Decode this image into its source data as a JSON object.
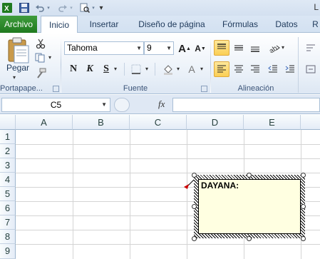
{
  "window": {
    "title_fragment": "L"
  },
  "qat": {
    "icons": [
      "excel-icon",
      "save-icon",
      "undo-icon",
      "redo-icon",
      "print-preview-icon",
      "customize-icon"
    ]
  },
  "tabs": [
    {
      "label": "Archivo"
    },
    {
      "label": "Inicio"
    },
    {
      "label": "Insertar"
    },
    {
      "label": "Diseño de página"
    },
    {
      "label": "Fórmulas"
    },
    {
      "label": "Datos"
    },
    {
      "label": "R"
    }
  ],
  "ribbon": {
    "clipboard": {
      "paste_label": "Pegar",
      "group_label": "Portapape..."
    },
    "font": {
      "font_name": "Tahoma",
      "font_size": "9",
      "bold": "N",
      "italic": "K",
      "underline": "S",
      "grow": "A",
      "shrink": "A",
      "font_color": "A",
      "group_label": "Fuente"
    },
    "alignment": {
      "group_label": "Alineación"
    }
  },
  "formula_bar": {
    "name_box": "C5",
    "fx": "fx",
    "value": ""
  },
  "grid": {
    "columns": [
      "A",
      "B",
      "C",
      "D",
      "E"
    ],
    "rows": [
      "1",
      "2",
      "3",
      "4",
      "5",
      "6",
      "7",
      "8",
      "9"
    ]
  },
  "comment": {
    "text": "DAYANA:"
  },
  "colors": {
    "file_tab": "#2a8a2a",
    "active_button": "#fbd86b",
    "comment_bg": "#ffffe1",
    "indicator": "#cc0000"
  }
}
